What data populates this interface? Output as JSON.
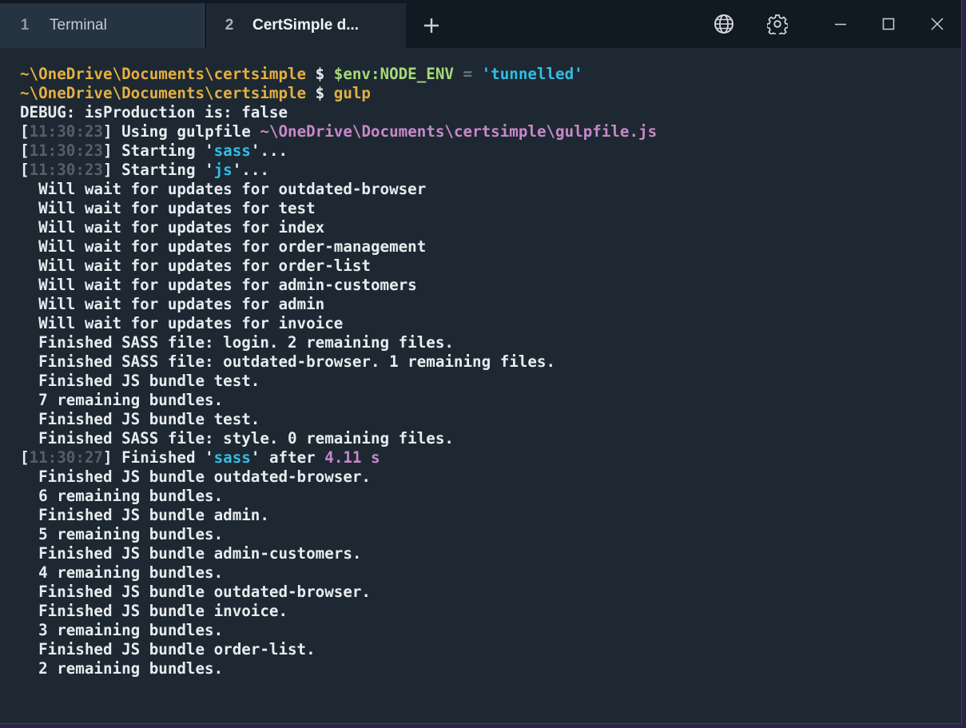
{
  "tabs": [
    {
      "num": "1",
      "title": "Terminal"
    },
    {
      "num": "2",
      "title": "CertSimple d..."
    }
  ],
  "icons": {
    "new_tab": "plus-icon",
    "globe": "globe-icon",
    "settings": "gear-icon",
    "minimize": "minimize-icon",
    "maximize": "maximize-icon",
    "close": "close-icon"
  },
  "colors": {
    "background": "#1d2833",
    "titlebar": "#111a22",
    "path": "#e4b03f",
    "variable": "#a8d87a",
    "string": "#33bde3",
    "timestamp": "#555f68",
    "file": "#c888c8",
    "text": "#e8ecef"
  },
  "terminal": {
    "lines": [
      {
        "path": "~\\OneDrive\\Documents\\certsimple",
        "prompt": " $ ",
        "var": "$env:NODE_ENV",
        "op": " = ",
        "str": "'tunnelled'"
      },
      {
        "path": "~\\OneDrive\\Documents\\certsimple",
        "prompt": " $ ",
        "cmd": "gulp"
      },
      {
        "text": "DEBUG: isProduction is: false"
      },
      {
        "ts": "11:30:23",
        "pre": " Using gulpfile ",
        "file": "~\\OneDrive\\Documents\\certsimple\\gulpfile.js"
      },
      {
        "ts": "11:30:23",
        "pre": " Starting '",
        "str": "sass",
        "post": "'..."
      },
      {
        "ts": "11:30:23",
        "pre": " Starting '",
        "str": "js",
        "post": "'..."
      },
      {
        "text": "  Will wait for updates for outdated-browser"
      },
      {
        "text": "  Will wait for updates for test"
      },
      {
        "text": "  Will wait for updates for index"
      },
      {
        "text": "  Will wait for updates for order-management"
      },
      {
        "text": "  Will wait for updates for order-list"
      },
      {
        "text": "  Will wait for updates for admin-customers"
      },
      {
        "text": "  Will wait for updates for admin"
      },
      {
        "text": "  Will wait for updates for invoice"
      },
      {
        "text": "  Finished SASS file: login. 2 remaining files."
      },
      {
        "text": "  Finished SASS file: outdated-browser. 1 remaining files."
      },
      {
        "text": "  Finished JS bundle test."
      },
      {
        "text": "  7 remaining bundles."
      },
      {
        "text": "  Finished JS bundle test."
      },
      {
        "text": "  Finished SASS file: style. 0 remaining files."
      },
      {
        "ts": "11:30:27",
        "pre": " Finished '",
        "str": "sass",
        "post": "' after ",
        "num": "4.11 s"
      },
      {
        "text": "  Finished JS bundle outdated-browser."
      },
      {
        "text": "  6 remaining bundles."
      },
      {
        "text": "  Finished JS bundle admin."
      },
      {
        "text": "  5 remaining bundles."
      },
      {
        "text": "  Finished JS bundle admin-customers."
      },
      {
        "text": "  4 remaining bundles."
      },
      {
        "text": "  Finished JS bundle outdated-browser."
      },
      {
        "text": "  Finished JS bundle invoice."
      },
      {
        "text": "  3 remaining bundles."
      },
      {
        "text": "  Finished JS bundle order-list."
      },
      {
        "text": "  2 remaining bundles."
      }
    ]
  }
}
